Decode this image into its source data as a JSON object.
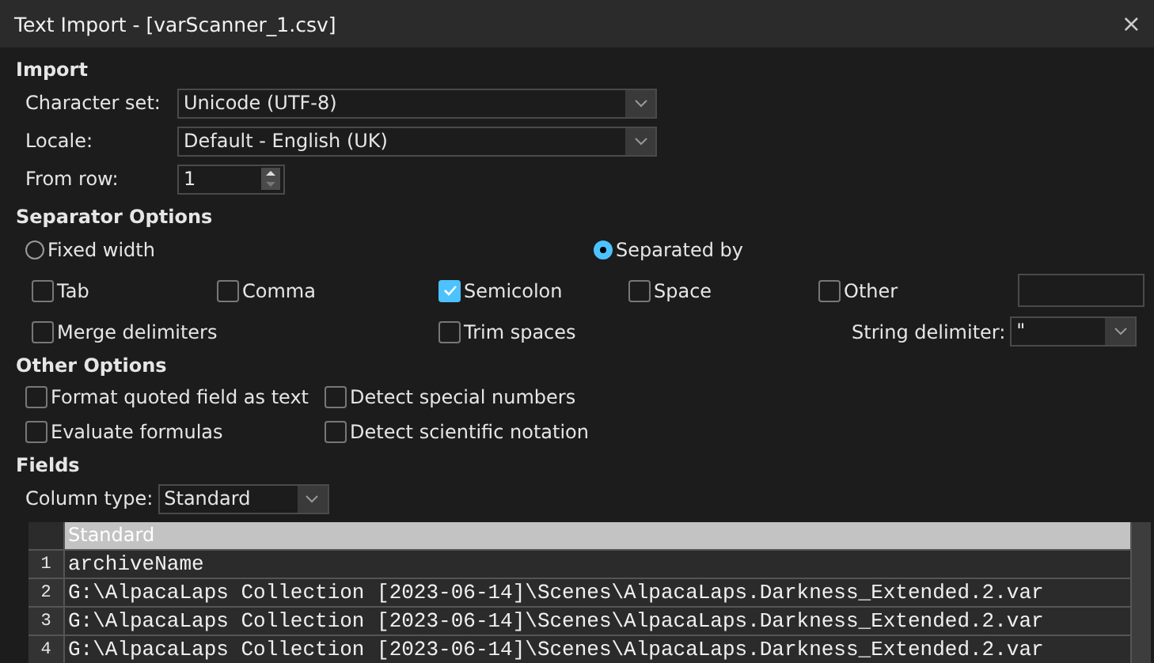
{
  "window": {
    "title": "Text Import - [varScanner_1.csv]",
    "close": "×"
  },
  "import": {
    "title": "Import",
    "fields": [
      {
        "kind": "dropdown",
        "label": "Character set:",
        "value": "Unicode (UTF-8)"
      },
      {
        "kind": "dropdown",
        "label": "Locale:",
        "value": "Default - English (UK)"
      },
      {
        "kind": "spin",
        "label": "From row:",
        "value": "1"
      }
    ]
  },
  "separator_options": {
    "title": "Separator Options",
    "modes": [
      {
        "label": "Fixed width",
        "selected": false
      },
      {
        "label": "Separated by",
        "selected": true
      }
    ],
    "row_1": [
      {
        "label": "Tab",
        "checked": false
      },
      {
        "label": "Comma",
        "checked": false
      },
      {
        "label": "Semicolon",
        "checked": true
      },
      {
        "label": "Space",
        "checked": false
      },
      {
        "label": "Other",
        "checked": false
      }
    ],
    "row_2": [
      {
        "label": "Merge delimiters",
        "checked": false
      },
      {
        "label": "Trim spaces",
        "checked": false
      }
    ],
    "string_delimiter": {
      "label": "String delimiter:",
      "value": "\""
    }
  },
  "other_options": {
    "title": "Other Options",
    "items": [
      {
        "label": "Format quoted field as text",
        "checked": false
      },
      {
        "label": "Detect special numbers",
        "checked": false
      },
      {
        "label": "Evaluate formulas",
        "checked": false
      },
      {
        "label": "Detect scientific notation",
        "checked": false
      }
    ]
  },
  "fields": {
    "title": "Fields",
    "column_type": {
      "label": "Column type:",
      "value": "Standard"
    },
    "preview": {
      "header": "Standard",
      "rows": [
        {
          "number": "1",
          "text": "archiveName"
        },
        {
          "number": "2",
          "text": "G:\\AlpacaLaps Collection [2023-06-14]\\Scenes\\AlpacaLaps.Darkness_Extended.2.var"
        },
        {
          "number": "3",
          "text": "G:\\AlpacaLaps Collection [2023-06-14]\\Scenes\\AlpacaLaps.Darkness_Extended.2.var"
        },
        {
          "number": "4",
          "text": "G:\\AlpacaLaps Collection [2023-06-14]\\Scenes\\AlpacaLaps.Darkness_Extended.2.var"
        }
      ]
    }
  }
}
